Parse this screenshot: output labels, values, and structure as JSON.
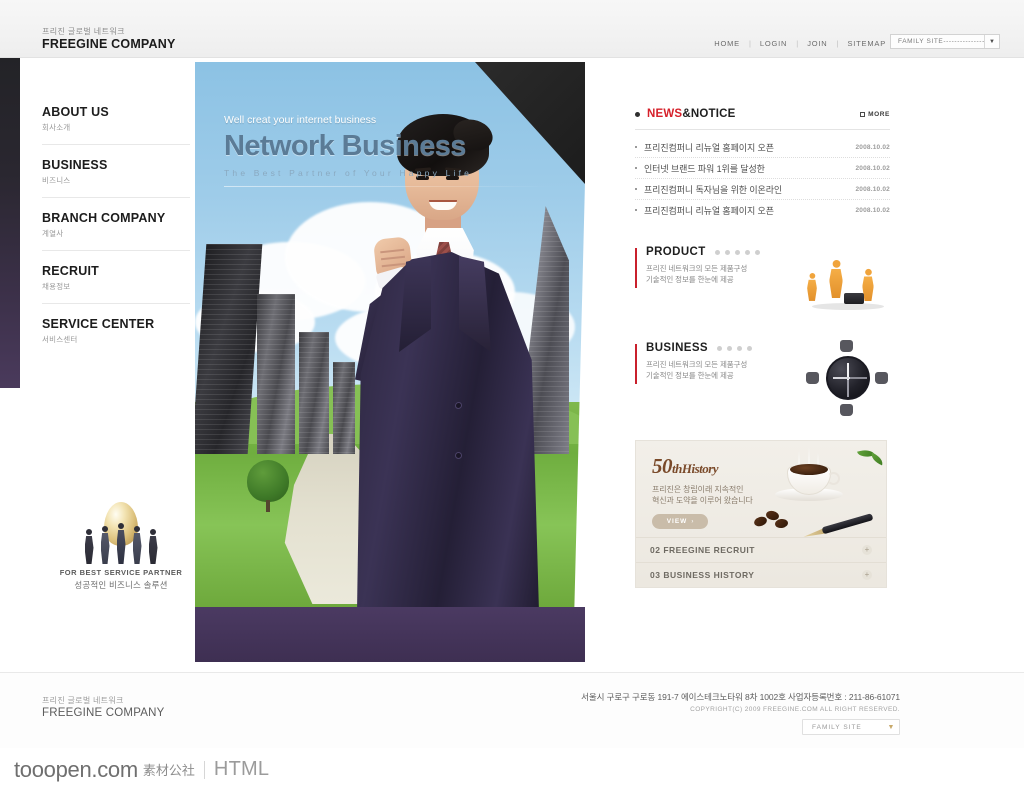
{
  "header": {
    "logo_kr": "프리진 글로벌 네트워크",
    "logo_en": "FREEGINE COMPANY",
    "nav": [
      {
        "label": "HOME"
      },
      {
        "label": "LOGIN"
      },
      {
        "label": "JOIN"
      },
      {
        "label": "SITEMAP"
      }
    ],
    "separator": "|",
    "family_site": "FAMILY SITE---------------",
    "family_arrow": "▼"
  },
  "sidebar": {
    "items": [
      {
        "en": "ABOUT US",
        "kr": "회사소개"
      },
      {
        "en": "BUSINESS",
        "kr": "비즈니스"
      },
      {
        "en": "BRANCH COMPANY",
        "kr": "계열사"
      },
      {
        "en": "RECRUIT",
        "kr": "채용정보"
      },
      {
        "en": "SERVICE CENTER",
        "kr": "서비스센터"
      }
    ],
    "banner": {
      "en": "FOR BEST SERVICE PARTNER",
      "kr": "성공적인 비즈니스 솔루션"
    }
  },
  "hero": {
    "tagline": "Well creat your internet business",
    "title": "Network Business",
    "subtitle": "The Best Partner of Your Happy Life"
  },
  "news": {
    "title_red": "NEWS",
    "title_black": "&NOTICE",
    "more_label": "MORE",
    "items": [
      {
        "text": "프리진컴퍼니 리뉴얼 홈페이지 오픈",
        "date": "2008.10.02"
      },
      {
        "text": "인터넷 브랜드 파워 1위를 달성한",
        "date": "2008.10.02"
      },
      {
        "text": "프리진컴퍼니 독자님을 위한 이온라인",
        "date": "2008.10.02"
      },
      {
        "text": "프리진컴퍼니 리뉴얼 홈페이지 오픈",
        "date": "2008.10.02"
      }
    ]
  },
  "promos": [
    {
      "title": "PRODUCT",
      "desc_line1": "프리진 네트워크의 모든 제품구성",
      "desc_line2": "기술적인 정보를 한눈에 제공",
      "art": "workers-icon"
    },
    {
      "title": "BUSINESS",
      "desc_line1": "프리진 네트워크의 모든 제품구성",
      "desc_line2": "기술적인 정보를 한눈에 제공",
      "art": "compass-icon"
    }
  ],
  "history": {
    "number": "50",
    "th": "th",
    "word": "History",
    "desc_line1": "프리진은 창립이래 지속적인",
    "desc_line2": "혁신과 도약을 이루어 왔습니다",
    "view_label": "VIEW",
    "view_arrow": "›",
    "links": [
      {
        "label": "02 FREEGINE RECRUIT",
        "plus": "+"
      },
      {
        "label": "03 BUSINESS HISTORY",
        "plus": "+"
      }
    ]
  },
  "footer": {
    "logo_kr": "프리진 글로벌 네트워크",
    "logo_en": "FREEGINE COMPANY",
    "address": "서울시 구로구 구로동 191-7 에이스테크노타워 8차 1002호  사업자등록번호 : 211-86-61071",
    "copyright": "COPYRIGHT(C) 2009 FREEGINE.COM ALL RIGHT RESERVED.",
    "family_site": "FAMILY SITE",
    "family_arrow": "▼"
  },
  "watermark": {
    "site": "tooopen.com",
    "cn": "素材公社",
    "type": "HTML"
  },
  "colors": {
    "accent_red": "#d6202a",
    "hero_sky": "#8cc2e4",
    "purple": "#4b3a62",
    "gold": "#c9bca9"
  }
}
